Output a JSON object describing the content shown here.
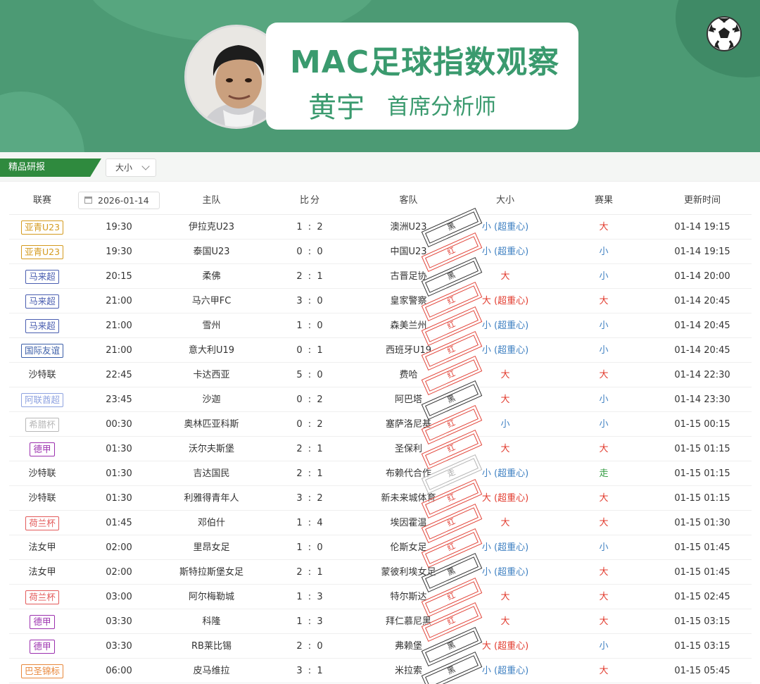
{
  "banner": {
    "title": "MAC足球指数观察",
    "name": "黄宇",
    "role": "首席分析师"
  },
  "tabs": {
    "active": "精品研报",
    "filter": "大小"
  },
  "table": {
    "headers": {
      "league": "联赛",
      "date": "2026-01-14",
      "home": "主队",
      "score": "比分",
      "away": "客队",
      "ou": "大小",
      "result": "赛果",
      "updated": "更新时间"
    },
    "rows": [
      {
        "league": "亚青U23",
        "league_color": "#d49a1e",
        "badge": true,
        "time": "19:30",
        "home": "伊拉克U23",
        "score": "1 : 2",
        "away": "澳洲U23",
        "stamp": "黑",
        "stamp_type": "black",
        "ou": "小 (超重心)",
        "ou_type": "small",
        "result": "大",
        "result_type": "big",
        "updated": "01-14 19:15"
      },
      {
        "league": "亚青U23",
        "league_color": "#d49a1e",
        "badge": true,
        "time": "19:30",
        "home": "泰国U23",
        "score": "0 : 0",
        "away": "中国U23",
        "stamp": "红",
        "stamp_type": "red",
        "ou": "小 (超重心)",
        "ou_type": "small",
        "result": "小",
        "result_type": "small",
        "updated": "01-14 19:15"
      },
      {
        "league": "马来超",
        "league_color": "#4a5eb0",
        "badge": true,
        "time": "20:15",
        "home": "柔佛",
        "score": "2 : 1",
        "away": "古晋足协",
        "stamp": "黑",
        "stamp_type": "black",
        "ou": "大",
        "ou_type": "big",
        "result": "小",
        "result_type": "small",
        "updated": "01-14 20:00"
      },
      {
        "league": "马来超",
        "league_color": "#4a5eb0",
        "badge": true,
        "time": "21:00",
        "home": "马六甲FC",
        "score": "3 : 0",
        "away": "皇家警察",
        "stamp": "红",
        "stamp_type": "red",
        "ou": "大 (超重心)",
        "ou_type": "big",
        "result": "大",
        "result_type": "big",
        "updated": "01-14 20:45"
      },
      {
        "league": "马来超",
        "league_color": "#4a5eb0",
        "badge": true,
        "time": "21:00",
        "home": "雪州",
        "score": "1 : 0",
        "away": "森美兰州",
        "stamp": "红",
        "stamp_type": "red",
        "ou": "小 (超重心)",
        "ou_type": "small",
        "result": "小",
        "result_type": "small",
        "updated": "01-14 20:45"
      },
      {
        "league": "国际友谊",
        "league_color": "#3b5ea8",
        "badge": true,
        "time": "21:00",
        "home": "意大利U19",
        "score": "0 : 1",
        "away": "西班牙U19",
        "stamp": "红",
        "stamp_type": "red",
        "ou": "小 (超重心)",
        "ou_type": "small",
        "result": "小",
        "result_type": "small",
        "updated": "01-14 20:45"
      },
      {
        "league": "沙特联",
        "league_color": "#333333",
        "badge": false,
        "time": "22:45",
        "home": "卡达西亚",
        "score": "5 : 0",
        "away": "费哈",
        "stamp": "红",
        "stamp_type": "red",
        "ou": "大",
        "ou_type": "big",
        "result": "大",
        "result_type": "big",
        "updated": "01-14 22:30"
      },
      {
        "league": "阿联酋超",
        "league_color": "#8fa3e0",
        "badge": true,
        "time": "23:45",
        "home": "沙迦",
        "score": "0 : 2",
        "away": "阿巴塔",
        "stamp": "黑",
        "stamp_type": "black",
        "ou": "大",
        "ou_type": "big",
        "result": "小",
        "result_type": "small",
        "updated": "01-14 23:30"
      },
      {
        "league": "希腊杯",
        "league_color": "#b8b8b8",
        "badge": true,
        "time": "00:30",
        "home": "奥林匹亚科斯",
        "score": "0 : 2",
        "away": "塞萨洛尼基",
        "stamp": "红",
        "stamp_type": "red",
        "ou": "小",
        "ou_type": "small",
        "result": "小",
        "result_type": "small",
        "updated": "01-15 00:15"
      },
      {
        "league": "德甲",
        "league_color": "#9b2fae",
        "badge": true,
        "time": "01:30",
        "home": "沃尔夫斯堡",
        "score": "2 : 1",
        "away": "圣保利",
        "stamp": "红",
        "stamp_type": "red",
        "ou": "大",
        "ou_type": "big",
        "result": "大",
        "result_type": "big",
        "updated": "01-15 01:15"
      },
      {
        "league": "沙特联",
        "league_color": "#333333",
        "badge": false,
        "time": "01:30",
        "home": "吉达国民",
        "score": "2 : 1",
        "away": "布赖代合作",
        "stamp": "走",
        "stamp_type": "gray",
        "ou": "小 (超重心)",
        "ou_type": "small",
        "result": "走",
        "result_type": "push",
        "updated": "01-15 01:15"
      },
      {
        "league": "沙特联",
        "league_color": "#333333",
        "badge": false,
        "time": "01:30",
        "home": "利雅得青年人",
        "score": "3 : 2",
        "away": "新未来城体育",
        "stamp": "红",
        "stamp_type": "red",
        "ou": "大 (超重心)",
        "ou_type": "big",
        "result": "大",
        "result_type": "big",
        "updated": "01-15 01:15"
      },
      {
        "league": "荷兰杯",
        "league_color": "#e35a5a",
        "badge": true,
        "time": "01:45",
        "home": "邓伯什",
        "score": "1 : 4",
        "away": "埃因霍温",
        "stamp": "红",
        "stamp_type": "red",
        "ou": "大",
        "ou_type": "big",
        "result": "大",
        "result_type": "big",
        "updated": "01-15 01:30"
      },
      {
        "league": "法女甲",
        "league_color": "#333333",
        "badge": false,
        "time": "02:00",
        "home": "里昂女足",
        "score": "1 : 0",
        "away": "伦斯女足",
        "stamp": "红",
        "stamp_type": "red",
        "ou": "小 (超重心)",
        "ou_type": "small",
        "result": "小",
        "result_type": "small",
        "updated": "01-15 01:45"
      },
      {
        "league": "法女甲",
        "league_color": "#333333",
        "badge": false,
        "time": "02:00",
        "home": "斯特拉斯堡女足",
        "score": "2 : 1",
        "away": "蒙彼利埃女足",
        "stamp": "黑",
        "stamp_type": "black",
        "ou": "小 (超重心)",
        "ou_type": "small",
        "result": "大",
        "result_type": "big",
        "updated": "01-15 01:45"
      },
      {
        "league": "荷兰杯",
        "league_color": "#e35a5a",
        "badge": true,
        "time": "03:00",
        "home": "阿尔梅勒城",
        "score": "1 : 3",
        "away": "特尔斯达",
        "stamp": "红",
        "stamp_type": "red",
        "ou": "大",
        "ou_type": "big",
        "result": "大",
        "result_type": "big",
        "updated": "01-15 02:45"
      },
      {
        "league": "德甲",
        "league_color": "#9b2fae",
        "badge": true,
        "time": "03:30",
        "home": "科隆",
        "score": "1 : 3",
        "away": "拜仁慕尼黑",
        "stamp": "红",
        "stamp_type": "red",
        "ou": "大",
        "ou_type": "big",
        "result": "大",
        "result_type": "big",
        "updated": "01-15 03:15"
      },
      {
        "league": "德甲",
        "league_color": "#9b2fae",
        "badge": true,
        "time": "03:30",
        "home": "RB莱比锡",
        "score": "2 : 0",
        "away": "弗赖堡",
        "stamp": "黑",
        "stamp_type": "black",
        "ou": "大 (超重心)",
        "ou_type": "big",
        "result": "小",
        "result_type": "small",
        "updated": "01-15 03:15"
      },
      {
        "league": "巴圣锦标",
        "league_color": "#e8873a",
        "badge": true,
        "time": "06:00",
        "home": "皮马维拉",
        "score": "3 : 1",
        "away": "米拉索",
        "stamp": "黑",
        "stamp_type": "black",
        "ou": "小 (超重心)",
        "ou_type": "small",
        "result": "大",
        "result_type": "big",
        "updated": "01-15 05:45"
      }
    ]
  }
}
